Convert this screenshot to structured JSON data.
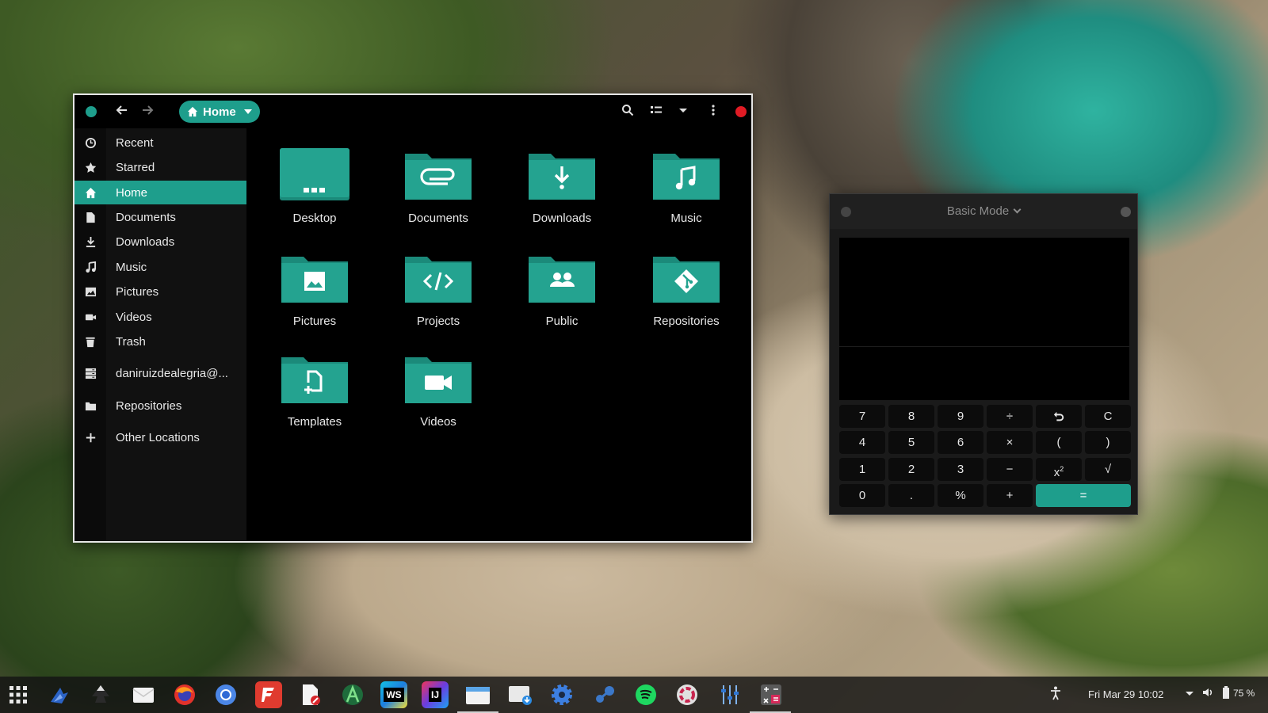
{
  "file_manager": {
    "path_label": "Home",
    "sidebar": [
      {
        "label": "Recent",
        "icon": "clock-icon"
      },
      {
        "label": "Starred",
        "icon": "star-icon"
      },
      {
        "label": "Home",
        "icon": "home-icon",
        "active": true
      },
      {
        "label": "Documents",
        "icon": "document-icon"
      },
      {
        "label": "Downloads",
        "icon": "download-icon"
      },
      {
        "label": "Music",
        "icon": "music-note-icon"
      },
      {
        "label": "Pictures",
        "icon": "image-icon"
      },
      {
        "label": "Videos",
        "icon": "video-camera-icon"
      },
      {
        "label": "Trash",
        "icon": "trash-icon"
      },
      {
        "label": "daniruizdealegria@...",
        "icon": "network-server-icon"
      },
      {
        "label": "Repositories",
        "icon": "folder-icon"
      },
      {
        "label": "Other Locations",
        "icon": "plus-icon"
      }
    ],
    "folders": [
      {
        "label": "Desktop",
        "icon": "desktop-dots-icon"
      },
      {
        "label": "Documents",
        "icon": "paperclip-icon"
      },
      {
        "label": "Downloads",
        "icon": "download-icon"
      },
      {
        "label": "Music",
        "icon": "music-note-icon"
      },
      {
        "label": "Pictures",
        "icon": "image-icon"
      },
      {
        "label": "Projects",
        "icon": "code-icon"
      },
      {
        "label": "Public",
        "icon": "people-icon"
      },
      {
        "label": "Repositories",
        "icon": "git-icon"
      },
      {
        "label": "Templates",
        "icon": "template-icon"
      },
      {
        "label": "Videos",
        "icon": "video-camera-icon"
      }
    ]
  },
  "calculator": {
    "mode_label": "Basic Mode",
    "keys": [
      [
        "7",
        "8",
        "9",
        "÷",
        "undo",
        "C"
      ],
      [
        "4",
        "5",
        "6",
        "×",
        "(",
        ")"
      ],
      [
        "1",
        "2",
        "3",
        "−",
        "x²",
        "√"
      ],
      [
        "0",
        ".",
        "%",
        "+",
        "="
      ]
    ]
  },
  "taskbar": {
    "apps": [
      "app-grid-icon",
      "tux-racer-icon",
      "inkscape-icon",
      "mail-icon",
      "firefox-icon",
      "chromium-icon",
      "filezilla-icon",
      "text-editor-icon",
      "android-studio-icon",
      "webstorm-icon",
      "intellij-icon",
      "files-icon",
      "downloader-icon",
      "settings-gear-icon",
      "steam-icon",
      "spotify-icon",
      "ubuntu-software-icon",
      "mixer-icon",
      "calculator-icon"
    ],
    "webstorm_text": "WS",
    "intellij_text": "IJ",
    "clock": "Fri Mar 29  10:02",
    "battery": "75 %"
  },
  "colors": {
    "accent": "#1e9e8c",
    "close": "#e01b24"
  }
}
